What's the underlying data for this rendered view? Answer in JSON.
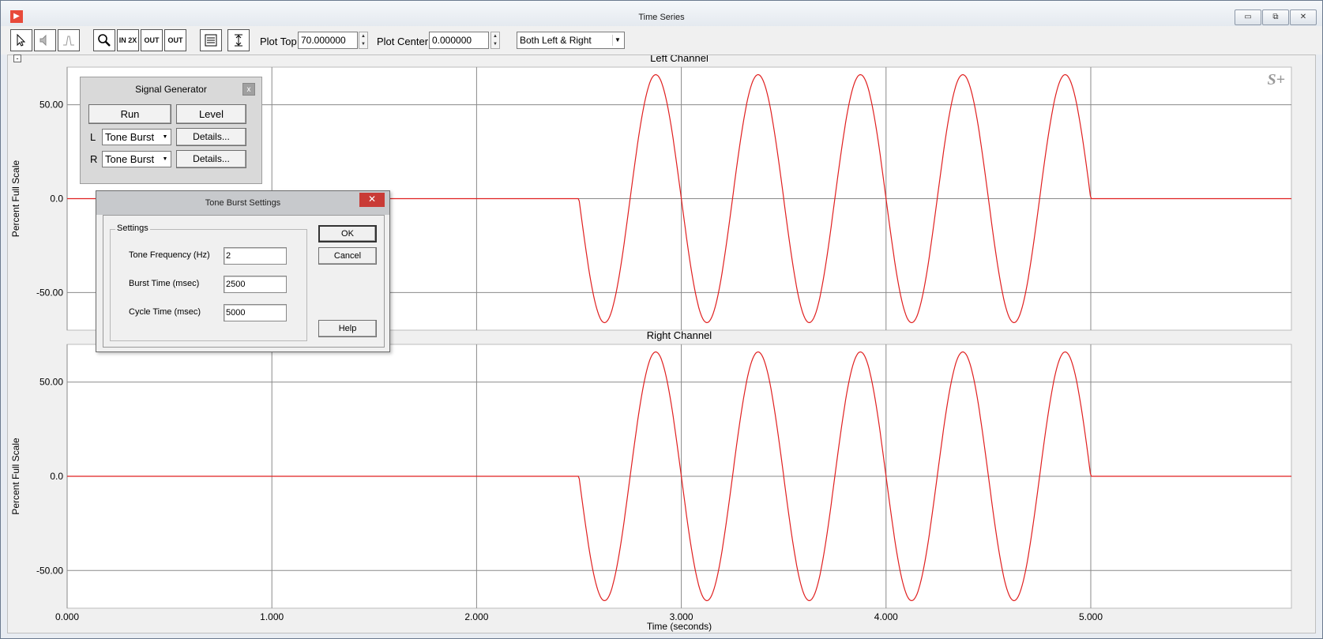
{
  "window": {
    "title": "Time Series",
    "icon": "app-icon",
    "controls": [
      "minimize-icon",
      "restore-icon",
      "close-icon"
    ],
    "minimize_glyph": "▭",
    "restore_glyph": "⧉",
    "close_glyph": "✕"
  },
  "toolbar": {
    "buttons": [
      {
        "name": "pointer-icon",
        "label": ""
      },
      {
        "name": "speaker-mute-icon",
        "label": ""
      },
      {
        "name": "spectrum-icon",
        "label": ""
      },
      {
        "name": "magnifier-icon",
        "label": ""
      },
      {
        "name": "zoom-in-2x-icon",
        "label": "IN 2X"
      },
      {
        "name": "zoom-out-2x-icon",
        "label": "OUT 2X"
      },
      {
        "name": "zoom-out-full-icon",
        "label": "OUT FULL"
      },
      {
        "name": "settings-panel-icon",
        "label": ""
      },
      {
        "name": "vertical-scale-icon",
        "label": ""
      }
    ],
    "plot_top_label": "Plot Top",
    "plot_top_value": "70.000000",
    "plot_center_label": "Plot Center",
    "plot_center_value": "0.000000",
    "channel_selected": "Both Left & Right"
  },
  "plot": {
    "collapse_glyph": "-",
    "brand_mark": "S+"
  },
  "signal_generator": {
    "title": "Signal Generator",
    "close_glyph": "x",
    "run_label": "Run",
    "level_label": "Level",
    "left_label": "L",
    "right_label": "R",
    "left_signal": "Tone Burst",
    "right_signal": "Tone Burst",
    "details_label": "Details..."
  },
  "dialog": {
    "title": "Tone Burst Settings",
    "close_glyph": "✕",
    "group_label": "Settings",
    "fields": [
      {
        "label": "Tone Frequency (Hz)",
        "value": "2"
      },
      {
        "label": "Burst Time (msec)",
        "value": "2500"
      },
      {
        "label": "Cycle Time (msec)",
        "value": "5000"
      }
    ],
    "ok_label": "OK",
    "cancel_label": "Cancel",
    "help_label": "Help"
  },
  "chart_data": [
    {
      "type": "line",
      "title": "Left Channel",
      "ylabel": "Percent Full Scale",
      "xlabel": "",
      "xlim": [
        0,
        5.98
      ],
      "ylim": [
        -70,
        70
      ],
      "yticks": [
        "50.00",
        "0.0",
        "-50.00"
      ],
      "ytick_values": [
        50,
        0,
        -50
      ],
      "xtick_values": [
        0,
        1,
        2,
        3,
        4,
        5
      ],
      "grid": true,
      "series": [
        {
          "color": "#e02020",
          "signal": {
            "start": 2.5,
            "end": 5.0,
            "frequency_hz": 2,
            "amplitude": 66,
            "phase": "negative-sine"
          }
        }
      ]
    },
    {
      "type": "line",
      "title": "Right Channel",
      "ylabel": "Percent Full Scale",
      "xlabel": "Time (seconds)",
      "xlim": [
        0,
        5.98
      ],
      "ylim": [
        -70,
        70
      ],
      "yticks": [
        "50.00",
        "0.0",
        "-50.00"
      ],
      "ytick_values": [
        50,
        0,
        -50
      ],
      "xtick_values": [
        0,
        1,
        2,
        3,
        4,
        5
      ],
      "xticks": [
        "0.000",
        "1.000",
        "2.000",
        "3.000",
        "4.000",
        "5.000"
      ],
      "grid": true,
      "series": [
        {
          "color": "#e02020",
          "signal": {
            "start": 2.5,
            "end": 5.0,
            "frequency_hz": 2,
            "amplitude": 66,
            "phase": "negative-sine"
          }
        }
      ]
    }
  ]
}
